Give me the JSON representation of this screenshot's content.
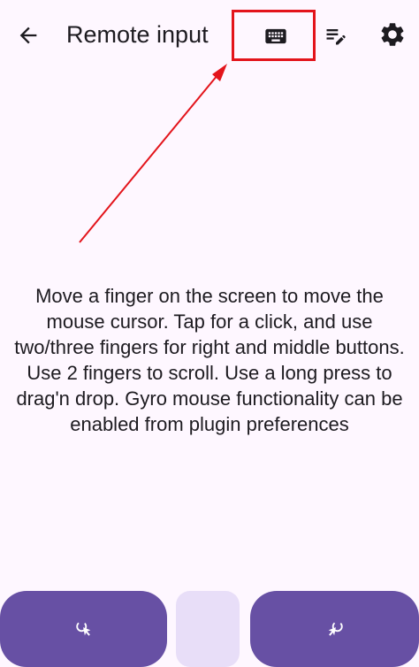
{
  "header": {
    "title": "Remote input",
    "icons": {
      "back": "arrow-back-icon",
      "keyboard": "keyboard-icon",
      "commands": "edit-note-icon",
      "settings": "gear-icon"
    }
  },
  "main": {
    "help_text": "Move a finger on the screen to move the mouse cursor. Tap for a click, and use two/three fingers for right and middle buttons. Use 2 fingers to scroll. Use a long press to drag'n drop. Gyro mouse functionality can be enabled from plugin preferences"
  },
  "bottom": {
    "left_icon": "left-click-icon",
    "right_icon": "right-click-icon"
  },
  "colors": {
    "background": "#FEF7FF",
    "primary": "#6750A4",
    "secondary_container": "#E8DEF8",
    "annotation_red": "#E3141B",
    "on_surface": "#1D1B20"
  }
}
